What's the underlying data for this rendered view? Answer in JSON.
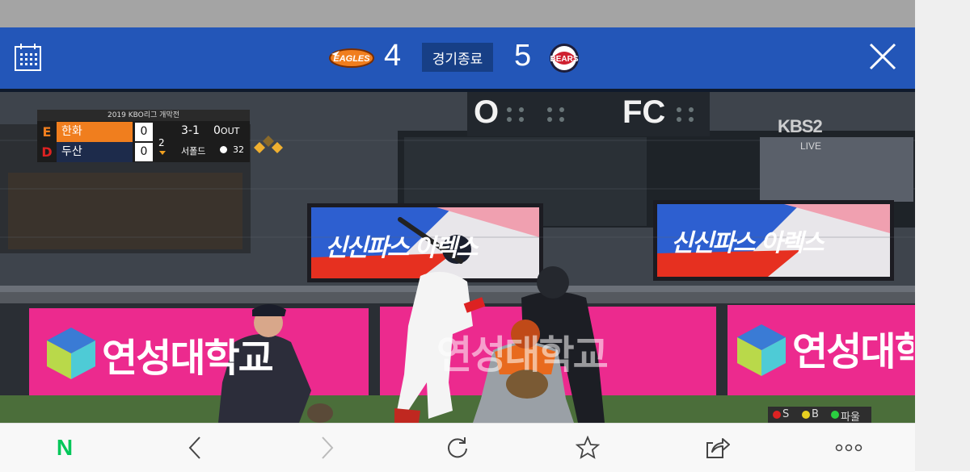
{
  "scorebar": {
    "home_team_logo": "EAGLES",
    "home_score": "4",
    "game_status": "경기종료",
    "away_score": "5",
    "away_team_logo": "BEARS",
    "bar_color": "#2356b8"
  },
  "broadcast": {
    "title": "2019 KBO리그 개막전",
    "team1_mark": "E",
    "team1_name": "한화",
    "team1_runs": "0",
    "team2_mark": "D",
    "team2_name": "두산",
    "team2_runs": "0",
    "inning": "2",
    "count": "3-1",
    "outs": "0",
    "out_label": "OUT",
    "pitcher": "서폴드",
    "pitch_count": "32",
    "channel": "KBS",
    "channel_num": "2",
    "live": "LIVE",
    "scoreboard_left": "O",
    "scoreboard_right": "FC",
    "ad_banner": "신신파스 아렉스",
    "ad_pink": "연성대학교",
    "sbo_s": "S",
    "sbo_b": "B",
    "sbo_foul": "파울"
  },
  "navbar": {
    "home_logo": "N",
    "icons": [
      "naver-home-icon",
      "back-icon",
      "forward-icon",
      "refresh-icon",
      "bookmark-icon",
      "share-icon",
      "more-icon"
    ]
  }
}
